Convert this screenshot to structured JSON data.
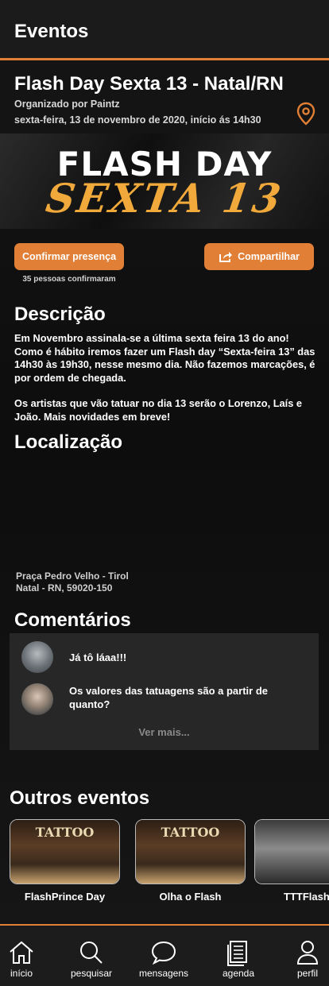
{
  "header": {
    "title": "Eventos"
  },
  "event": {
    "title": "Flash Day Sexta 13 - Natal/RN",
    "organizer": "Organizado por Paintz",
    "datetime": "sexta-feira, 13 de novembro de 2020, início ás 14h30",
    "banner_line1": "FLASH DAY",
    "banner_line2": "SEXTA 13"
  },
  "actions": {
    "confirm_label": "Confirmar presença",
    "confirm_count": "35 pessoas confirmaram",
    "share_label": "Compartilhar"
  },
  "description": {
    "heading": "Descrição",
    "paragraph1": "Em Novembro assinala-se a última sexta feira 13 do ano! Como é hábito iremos fazer um Flash day “Sexta-feira 13” das 14h30 às 19h30, nesse mesmo dia. Não fazemos marcações, é por ordem de chegada.",
    "paragraph2": "Os artistas que vão tatuar no dia 13 serão o Lorenzo, Laís e João. Mais novidades em breve!"
  },
  "location": {
    "heading": "Localização",
    "address_line1": "Praça Pedro Velho - Tirol",
    "address_line2": "Natal - RN, 59020-150"
  },
  "comments": {
    "heading": "Comentários",
    "items": [
      {
        "text": "Já tô láaa!!!"
      },
      {
        "text": "Os valores das tatuagens são a partir de quanto?"
      }
    ],
    "more_label": "Ver mais..."
  },
  "other_events": {
    "heading": "Outros eventos",
    "items": [
      {
        "title": "FlashPrince Day",
        "sign": "TATTOO"
      },
      {
        "title": "Olha o Flash",
        "sign": "TATTOO"
      },
      {
        "title": "TTTFlash"
      }
    ]
  },
  "nav": {
    "items": [
      {
        "label": "início",
        "icon": "home-icon"
      },
      {
        "label": "pesquisar",
        "icon": "search-icon"
      },
      {
        "label": "mensagens",
        "icon": "chat-icon"
      },
      {
        "label": "agenda",
        "icon": "calendar-icon"
      },
      {
        "label": "perfil",
        "icon": "user-icon"
      }
    ]
  },
  "colors": {
    "accent": "#e07f35",
    "background": "#141414",
    "card": "#272727",
    "banner_script": "#f0a93a"
  }
}
